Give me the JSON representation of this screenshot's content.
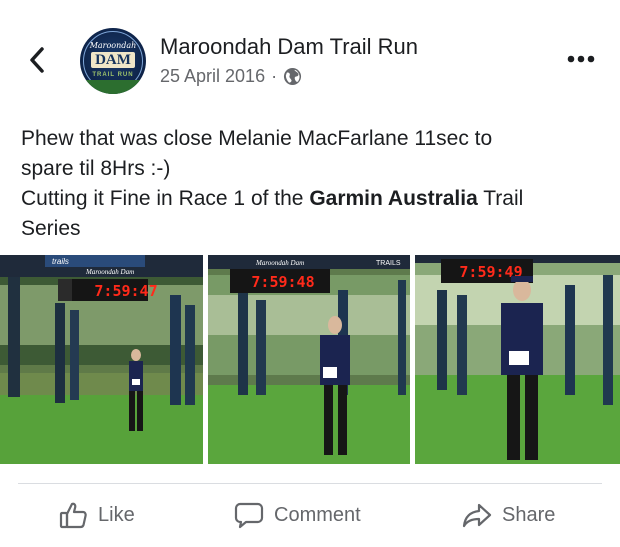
{
  "header": {
    "page_name": "Maroondah Dam Trail Run",
    "date": "25 April 2016",
    "separator": "·",
    "avatar_logo_text": {
      "top": "Maroondah",
      "main": "DAM",
      "sub": "TRAIL RUN"
    }
  },
  "post": {
    "line1": "Phew that was close Melanie MacFarlane 11sec to",
    "line2": "spare til 8Hrs :-)",
    "line3_before": "Cutting it Fine in Race 1 of the ",
    "line3_bold": "Garmin Australia",
    "line3_after": " Trail",
    "line4": "Series"
  },
  "photos": [
    {
      "clock": "7:59:47",
      "banner": "trails",
      "banner_sub": "Maroondah Dam"
    },
    {
      "clock": "7:59:48",
      "banner": "TRAILS",
      "banner_sub": "Maroondah Dam"
    },
    {
      "clock": "7:59:49",
      "banner": "",
      "banner_sub": ""
    }
  ],
  "actions": {
    "like": "Like",
    "comment": "Comment",
    "share": "Share"
  },
  "icons": {
    "back": "chevron-left-icon",
    "more": "more-horizontal-icon",
    "privacy": "globe-icon",
    "like": "thumbs-up-icon",
    "comment": "comment-bubble-icon",
    "share": "share-arrow-icon"
  },
  "colors": {
    "text": "#1c1e21",
    "secondary": "#65676b",
    "divider": "#dadde1",
    "clock_red": "#ff2a1a"
  }
}
